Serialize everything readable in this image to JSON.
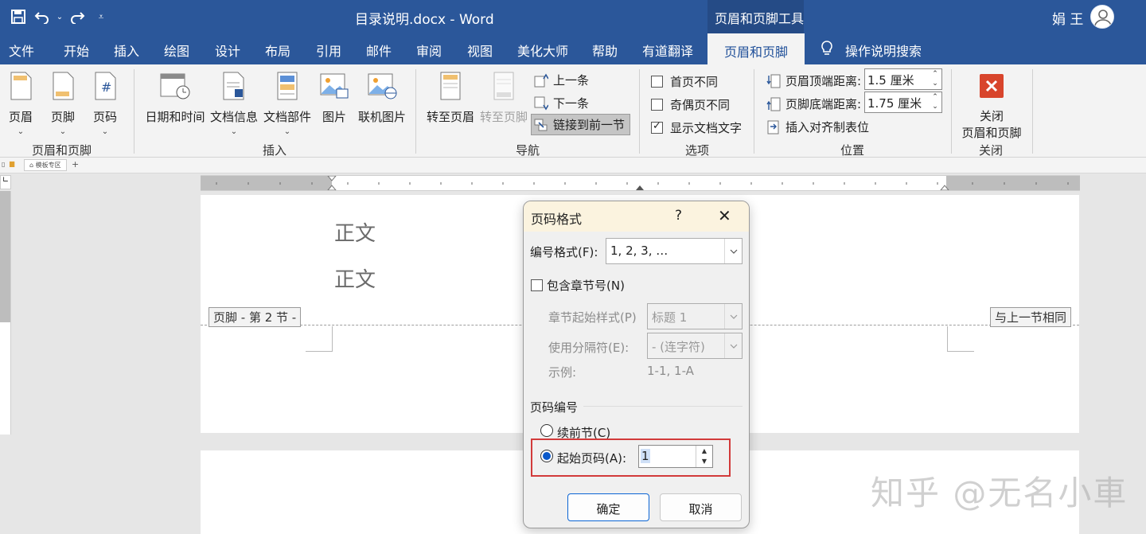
{
  "window": {
    "doc_title": "目录说明.docx  -  Word",
    "context_tools": "页眉和页脚工具",
    "user": "娟 王"
  },
  "tabs": [
    "文件",
    "开始",
    "插入",
    "绘图",
    "设计",
    "布局",
    "引用",
    "邮件",
    "审阅",
    "视图",
    "美化大师",
    "帮助",
    "有道翻译",
    "页眉和页脚",
    "操作说明搜索"
  ],
  "ribbon": {
    "hf_group": {
      "label": "页眉和页脚",
      "header": "页眉",
      "footer": "页脚",
      "page_number": "页码"
    },
    "insert_group": {
      "label": "插入",
      "datetime": "日期和时间",
      "docinfo": "文档信息",
      "docparts": "文档部件",
      "picture": "图片",
      "online_picture": "联机图片"
    },
    "nav_group": {
      "label": "导航",
      "goto_header": "转至页眉",
      "goto_footer": "转至页脚",
      "previous": "上一条",
      "next": "下一条",
      "link_prev": "链接到前一节"
    },
    "options_group": {
      "label": "选项",
      "diff_first": "首页不同",
      "diff_odd_even": "奇偶页不同",
      "show_doc_text": "显示文档文字"
    },
    "position_group": {
      "label": "位置",
      "header_top": "页眉顶端距离:",
      "header_top_val": "1.5 厘米",
      "footer_bottom": "页脚底端距离:",
      "footer_bottom_val": "1.75 厘米",
      "insert_align_tab": "插入对齐制表位"
    },
    "close_group": {
      "label": "关闭",
      "close_line1": "关闭",
      "close_line2": "页眉和页脚"
    }
  },
  "ministrip": {
    "item": "模板专区",
    "plus": "+"
  },
  "page": {
    "body_line1": "正文",
    "body_line2": "正文",
    "footer_label": "页脚 - 第 2 节 -",
    "same_as_prev": "与上一节相同"
  },
  "dialog": {
    "title": "页码格式",
    "help": "?",
    "close": "✕",
    "number_format_label": "编号格式(F):",
    "number_format_value": "1, 2, 3, …",
    "include_chapter": "包含章节号(N)",
    "chapter_style_label": "章节起始样式(P)",
    "chapter_style_value": "标题 1",
    "separator_label": "使用分隔符(E):",
    "separator_value": "-  (连字符)",
    "example_label": "示例:",
    "example_value": "1-1, 1-A",
    "page_numbering": "页码编号",
    "continue_prev": "续前节(C)",
    "start_at": "起始页码(A):",
    "start_at_value": "1",
    "ok": "确定",
    "cancel": "取消"
  },
  "watermark": "知乎 @无名小車",
  "colors": {
    "title_bar": "#2b579a",
    "ribbon_bg": "#f3f3f3",
    "highlight_box": "#d23a3a",
    "radio_on": "#0a58ca"
  }
}
